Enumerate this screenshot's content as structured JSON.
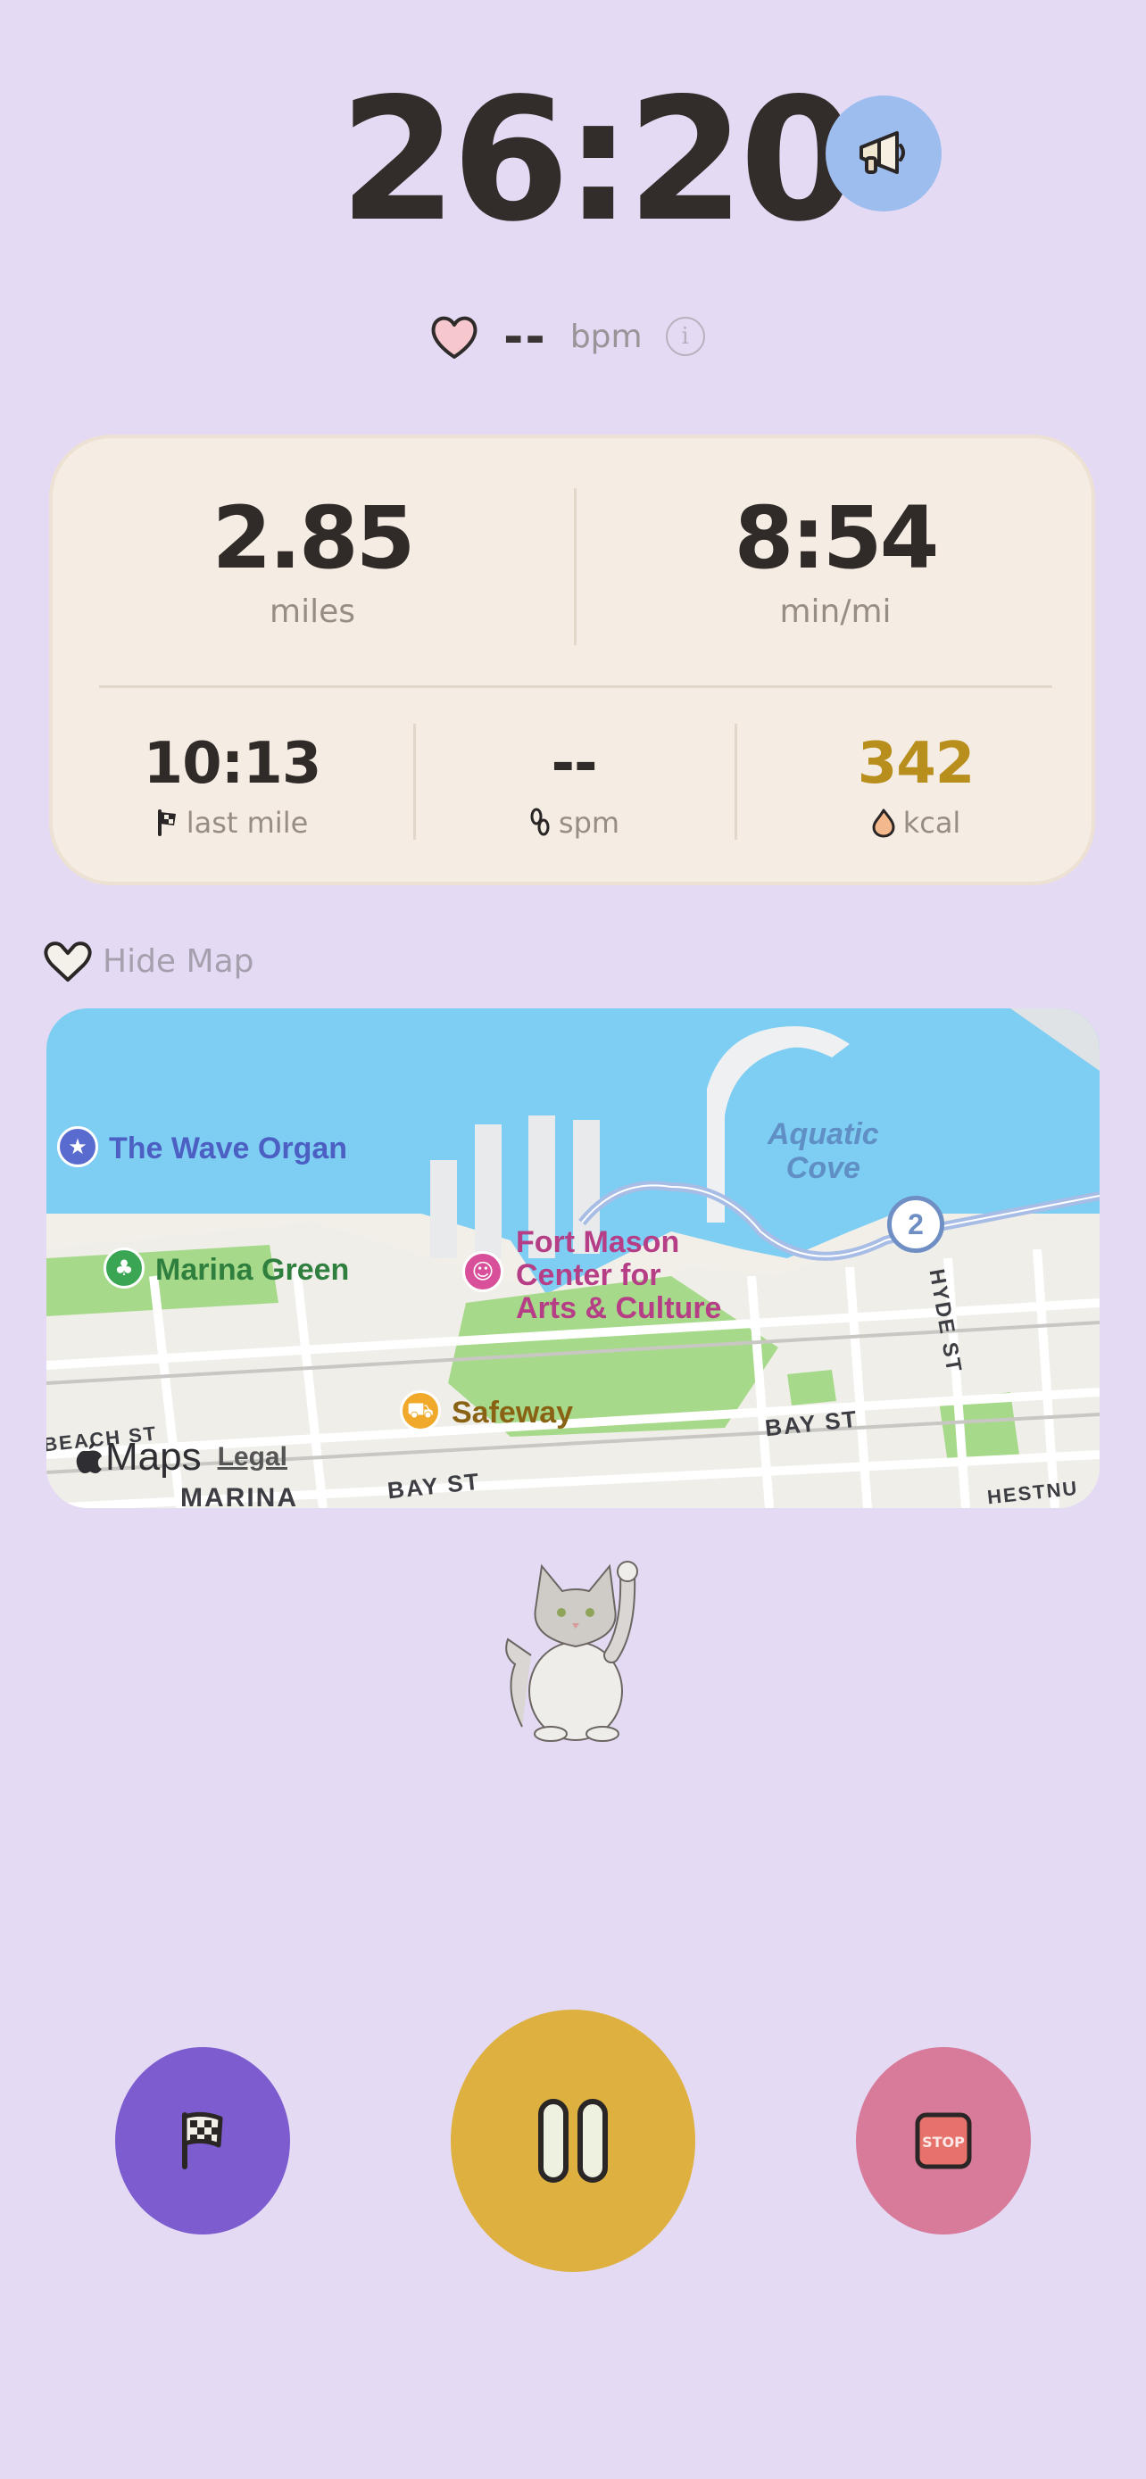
{
  "timer": {
    "elapsed": "26:20"
  },
  "heart_rate": {
    "value": "--",
    "unit": "bpm"
  },
  "stats": {
    "distance": {
      "value": "2.85",
      "label": "miles"
    },
    "pace": {
      "value": "8:54",
      "label": "min/mi"
    },
    "last_mile": {
      "value": "10:13",
      "label": "last mile"
    },
    "cadence": {
      "value": "--",
      "label": "spm"
    },
    "calories": {
      "value": "342",
      "label": "kcal",
      "color": "#b88f1d"
    }
  },
  "map_toggle": {
    "label": "Hide Map"
  },
  "map": {
    "pois": {
      "wave_organ": "The Wave Organ",
      "marina_green": "Marina Green",
      "fort_mason_1": "Fort Mason",
      "fort_mason_2": "Center for",
      "fort_mason_3": "Arts & Culture",
      "safeway": "Safeway",
      "aquatic_cove_1": "Aquatic",
      "aquatic_cove_2": "Cove"
    },
    "streets": {
      "bay_st_1": "BAY ST",
      "bay_st_2": "BAY ST",
      "beach_st": "BEACH ST",
      "hyde_st": "HYDE ST",
      "chestnut": "HESTNU",
      "marina": "MARINA"
    },
    "mile_marker": "2",
    "attribution": {
      "brand": "Maps",
      "legal": "Legal"
    }
  },
  "controls": {
    "lap": "checkered-flag-icon",
    "pause": "pause-icon",
    "stop": "stop-sign-icon"
  },
  "colors": {
    "background": "#e4daf4",
    "card": "#f5ece3",
    "lap_button": "#7d5ccf",
    "pause_button": "#ddb03f",
    "stop_button": "#d87a9a",
    "announce_button": "#9dbdee"
  }
}
